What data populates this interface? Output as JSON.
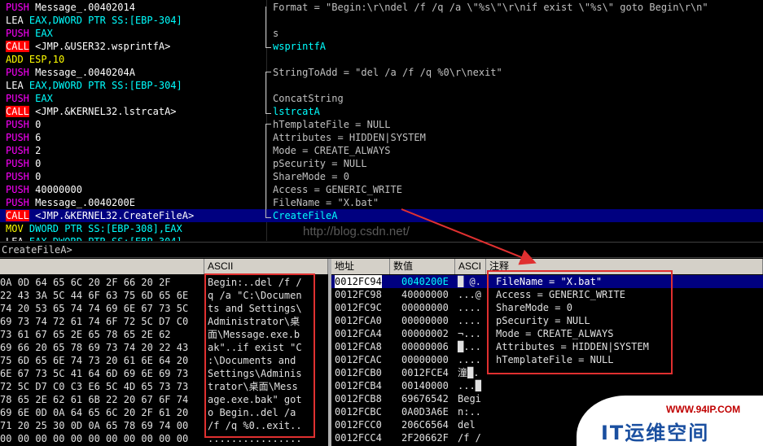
{
  "disasm": {
    "rows": [
      {
        "code": [
          [
            "push",
            "PUSH"
          ],
          [
            "tgt",
            " Message_.00402014"
          ]
        ],
        "comment": "Format = \"Begin:\\r\\ndel /f /q /a \\\"%s\\\"\\r\\nif exist \\\"%s\\\" goto Begin\\r\\n\""
      },
      {
        "code": [
          [
            "lea",
            "LEA "
          ],
          [
            "reg",
            "EAX,DWORD PTR SS:[EBP-304]"
          ]
        ],
        "comment": ""
      },
      {
        "code": [
          [
            "push",
            "PUSH"
          ],
          [
            "reg",
            " EAX"
          ]
        ],
        "comment": "s"
      },
      {
        "code": [
          [
            "callbg",
            "CALL"
          ],
          [
            "tgt",
            " <JMP.&USER32.wsprintfA>"
          ]
        ],
        "comment": "wsprintfA"
      },
      {
        "code": [
          [
            "add",
            "ADD ESP,10"
          ]
        ],
        "comment": ""
      },
      {
        "code": [
          [
            "push",
            "PUSH"
          ],
          [
            "tgt",
            " Message_.0040204A"
          ]
        ],
        "comment": "StringToAdd = \"del /a /f /q %0\\r\\nexit\""
      },
      {
        "code": [
          [
            "lea",
            "LEA "
          ],
          [
            "reg",
            "EAX,DWORD PTR SS:[EBP-304]"
          ]
        ],
        "comment": ""
      },
      {
        "code": [
          [
            "push",
            "PUSH"
          ],
          [
            "reg",
            " EAX"
          ]
        ],
        "comment": "ConcatString"
      },
      {
        "code": [
          [
            "callbg",
            "CALL"
          ],
          [
            "tgt",
            " <JMP.&KERNEL32.lstrcatA>"
          ]
        ],
        "comment": "lstrcatA"
      },
      {
        "code": [
          [
            "push",
            "PUSH"
          ],
          [
            "tgt",
            " 0"
          ]
        ],
        "comment": "hTemplateFile = NULL"
      },
      {
        "code": [
          [
            "push",
            "PUSH"
          ],
          [
            "tgt",
            " 6"
          ]
        ],
        "comment": "Attributes = HIDDEN|SYSTEM"
      },
      {
        "code": [
          [
            "push",
            "PUSH"
          ],
          [
            "tgt",
            " 2"
          ]
        ],
        "comment": "Mode = CREATE_ALWAYS"
      },
      {
        "code": [
          [
            "push",
            "PUSH"
          ],
          [
            "tgt",
            " 0"
          ]
        ],
        "comment": "pSecurity = NULL"
      },
      {
        "code": [
          [
            "push",
            "PUSH"
          ],
          [
            "tgt",
            " 0"
          ]
        ],
        "comment": "ShareMode = 0"
      },
      {
        "code": [
          [
            "push",
            "PUSH"
          ],
          [
            "tgt",
            " 40000000"
          ]
        ],
        "comment": "Access = GENERIC_WRITE"
      },
      {
        "code": [
          [
            "push",
            "PUSH"
          ],
          [
            "tgt",
            " Message_.0040200E"
          ]
        ],
        "comment": "FileName = \"X.bat\""
      },
      {
        "code": [
          [
            "callbg",
            "CALL"
          ],
          [
            "tgt",
            " <JMP.&KERNEL32.CreateFileA>"
          ]
        ],
        "comment": "CreateFileA"
      },
      {
        "code": [
          [
            "mov",
            "MOV "
          ],
          [
            "reg",
            "DWORD PTR SS:[EBP-308],EAX"
          ]
        ],
        "comment": ""
      },
      {
        "code": [
          [
            "lea",
            "LEA "
          ],
          [
            "reg",
            "EAX,DWORD PTR SS:[EBP-304]"
          ]
        ],
        "comment": ""
      }
    ]
  },
  "info_line": "CreateFileA>",
  "watermark_csdn": "http://blog.csdn.net/",
  "dump": {
    "ascii_header": "ASCII",
    "rows": [
      {
        "hex": "0A 0D 64 65 6C 20 2F 66 20 2F",
        "ascii": "Begin:..del /f /"
      },
      {
        "hex": "22 43 3A 5C 44 6F 63 75 6D 65 6E",
        "ascii": "q /a \"C:\\Documen"
      },
      {
        "hex": "74 20 53 65 74 74 69 6E 67 73 5C",
        "ascii": "ts and Settings\\"
      },
      {
        "hex": "69 73 74 72 61 74 6F 72 5C D7 C0",
        "ascii": "Administrator\\桌"
      },
      {
        "hex": "73 61 67 65 2E 65 78 65 2E 62",
        "ascii": "面\\Message.exe.b"
      },
      {
        "hex": "69 66 20 65 78 69 73 74 20 22 43",
        "ascii": "ak\"..if exist \"C"
      },
      {
        "hex": "75 6D 65 6E 74 73 20 61 6E 64 20",
        "ascii": ":\\Documents and "
      },
      {
        "hex": "6E 67 73 5C 41 64 6D 69 6E 69 73",
        "ascii": "Settings\\Adminis"
      },
      {
        "hex": "72 5C D7 C0 C3 E6 5C 4D 65 73 73",
        "ascii": "trator\\桌面\\Mess"
      },
      {
        "hex": "78 65 2E 62 61 6B 22 20 67 6F 74",
        "ascii": "age.exe.bak\" got"
      },
      {
        "hex": "69 6E 0D 0A 64 65 6C 20 2F 61 20",
        "ascii": "o Begin..del /a "
      },
      {
        "hex": "71 20 25 30 0D 0A 65 78 69 74 00",
        "ascii": "/f /q %0..exit.."
      },
      {
        "hex": "00 00 00 00 00 00 00 00 00 00 00",
        "ascii": "................"
      }
    ]
  },
  "stack": {
    "headers": {
      "addr": "地址",
      "value": "数值",
      "ascii": "ASCI",
      "comment": "注释"
    },
    "rows": [
      {
        "addr": "0012FC94",
        "value": "0040200E",
        "ascii": "█ @.",
        "comment": "FileName = \"X.bat\""
      },
      {
        "addr": "0012FC98",
        "value": "40000000",
        "ascii": "...@",
        "comment": "Access = GENERIC_WRITE"
      },
      {
        "addr": "0012FC9C",
        "value": "00000000",
        "ascii": "....",
        "comment": "ShareMode = 0"
      },
      {
        "addr": "0012FCA0",
        "value": "00000000",
        "ascii": "....",
        "comment": "pSecurity = NULL"
      },
      {
        "addr": "0012FCA4",
        "value": "00000002",
        "ascii": "¬...",
        "comment": "Mode = CREATE_ALWAYS"
      },
      {
        "addr": "0012FCA8",
        "value": "00000006",
        "ascii": "█...",
        "comment": "Attributes = HIDDEN|SYSTEM"
      },
      {
        "addr": "0012FCAC",
        "value": "00000000",
        "ascii": "....",
        "comment": "hTemplateFile = NULL"
      },
      {
        "addr": "0012FCB0",
        "value": "0012FCE4",
        "ascii": "潼█.",
        "comment": ""
      },
      {
        "addr": "0012FCB4",
        "value": "00140000",
        "ascii": "...█",
        "comment": ""
      },
      {
        "addr": "0012FCB8",
        "value": "69676542",
        "ascii": "Begi",
        "comment": ""
      },
      {
        "addr": "0012FCBC",
        "value": "0A0D3A6E",
        "ascii": "n:..",
        "comment": ""
      },
      {
        "addr": "0012FCC0",
        "value": "206C6564",
        "ascii": "del ",
        "comment": ""
      },
      {
        "addr": "0012FCC4",
        "value": "2F20662F",
        "ascii": "/f /",
        "comment": ""
      }
    ]
  },
  "logo": {
    "url": "WWW.94IP.COM",
    "name": "IT运维空间"
  }
}
